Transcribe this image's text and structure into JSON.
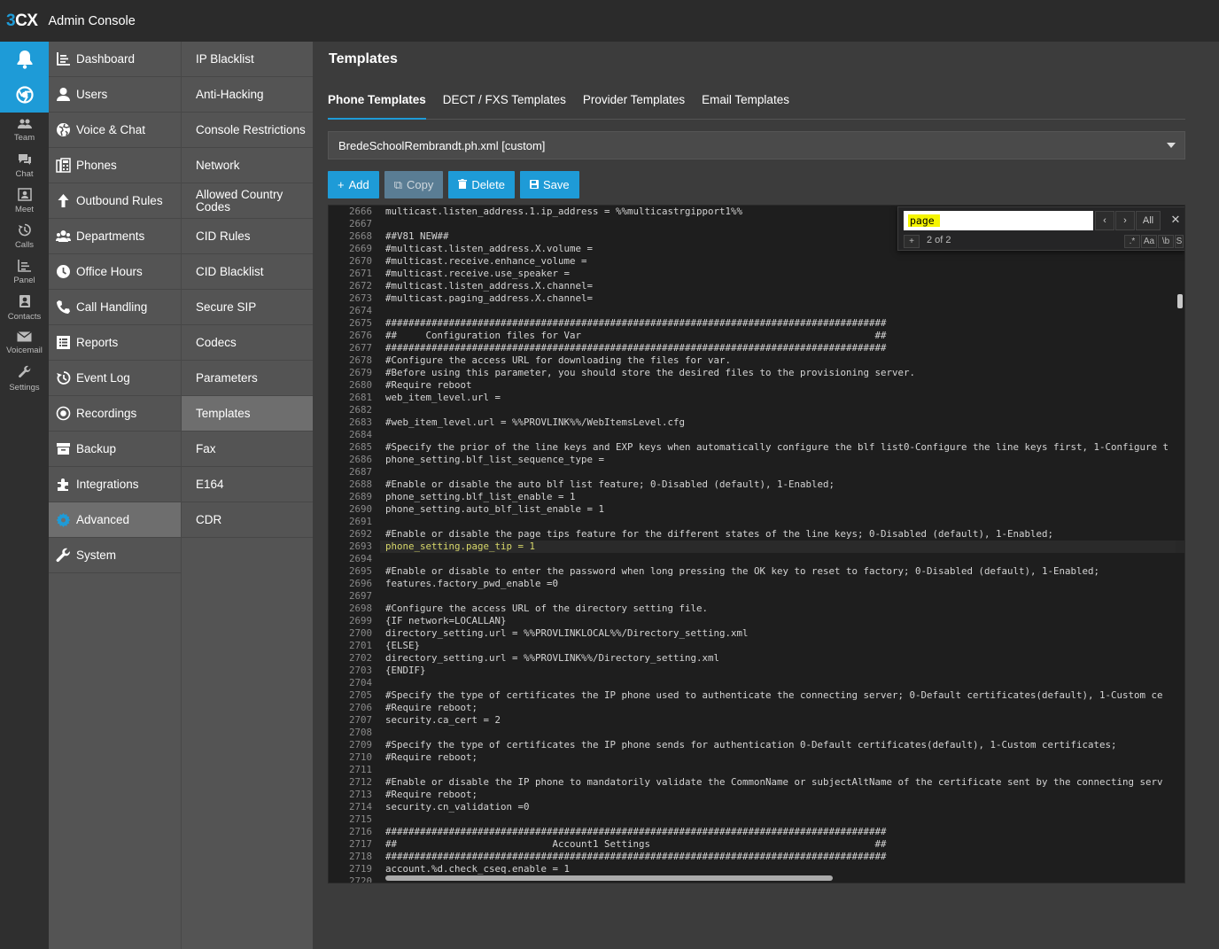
{
  "app": {
    "logo_prefix": "3",
    "logo_suffix": "CX",
    "title": "Admin Console"
  },
  "iconbar": {
    "items": [
      {
        "label": "Team",
        "icon": "team-icon"
      },
      {
        "label": "Chat",
        "icon": "chat-icon"
      },
      {
        "label": "Meet",
        "icon": "meet-icon"
      },
      {
        "label": "Calls",
        "icon": "calls-icon"
      },
      {
        "label": "Panel",
        "icon": "panel-icon"
      },
      {
        "label": "Contacts",
        "icon": "contacts-icon"
      },
      {
        "label": "Voicemail",
        "icon": "voicemail-icon"
      },
      {
        "label": "Settings",
        "icon": "settings-icon"
      }
    ]
  },
  "menu1": [
    "Dashboard",
    "Users",
    "Voice & Chat",
    "Phones",
    "Outbound Rules",
    "Departments",
    "Office Hours",
    "Call Handling",
    "Reports",
    "Event Log",
    "Recordings",
    "Backup",
    "Integrations",
    "Advanced",
    "System"
  ],
  "menu2": [
    "IP Blacklist",
    "Anti-Hacking",
    "Console Restrictions",
    "Network",
    "Allowed Country Codes",
    "CID Rules",
    "CID Blacklist",
    "Secure SIP",
    "Codecs",
    "Parameters",
    "Templates",
    "Fax",
    "E164",
    "CDR"
  ],
  "page": {
    "title": "Templates"
  },
  "tabs": [
    "Phone Templates",
    "DECT / FXS Templates",
    "Provider Templates",
    "Email Templates"
  ],
  "select": {
    "value": "BredeSchoolRembrandt.ph.xml [custom]"
  },
  "buttons": {
    "add": "Add",
    "copy": "Copy",
    "delete": "Delete",
    "save": "Save"
  },
  "find": {
    "query": "page",
    "count": "2 of 2",
    "all": "All",
    "regex": ".*",
    "case": "Aa",
    "word": "\\b",
    "s": "S",
    "plus": "+"
  },
  "editor": {
    "lines": [
      {
        "n": "2666",
        "t": "multicast.listen_address.1.ip_address = %%multicastrgipport1%%"
      },
      {
        "n": "2667",
        "t": ""
      },
      {
        "n": "2668",
        "t": "##V81 NEW##"
      },
      {
        "n": "2669",
        "t": "#multicast.listen_address.X.volume ="
      },
      {
        "n": "2670",
        "t": "#multicast.receive.enhance_volume ="
      },
      {
        "n": "2671",
        "t": "#multicast.receive.use_speaker ="
      },
      {
        "n": "2672",
        "t": "#multicast.listen_address.X.channel="
      },
      {
        "n": "2673",
        "t": "#multicast.paging_address.X.channel="
      },
      {
        "n": "2674",
        "t": ""
      },
      {
        "n": "2675",
        "t": "#######################################################################################"
      },
      {
        "n": "2676",
        "t": "##     Configuration files for Var                                                   ##"
      },
      {
        "n": "2677",
        "t": "#######################################################################################"
      },
      {
        "n": "2678",
        "t": "#Configure the access URL for downloading the files for var."
      },
      {
        "n": "2679",
        "t": "#Before using this parameter, you should store the desired files to the provisioning server."
      },
      {
        "n": "2680",
        "t": "#Require reboot"
      },
      {
        "n": "2681",
        "t": "web_item_level.url ="
      },
      {
        "n": "2682",
        "t": ""
      },
      {
        "n": "2683",
        "t": "#web_item_level.url = %%PROVLINK%%/WebItemsLevel.cfg"
      },
      {
        "n": "2684",
        "t": ""
      },
      {
        "n": "2685",
        "t": "#Specify the prior of the line keys and EXP keys when automatically configure the blf list0-Configure the line keys first, 1-Configure t"
      },
      {
        "n": "2686",
        "t": "phone_setting.blf_list_sequence_type ="
      },
      {
        "n": "2687",
        "t": ""
      },
      {
        "n": "2688",
        "t": "#Enable or disable the auto blf list feature; 0-Disabled (default), 1-Enabled;"
      },
      {
        "n": "2689",
        "t": "phone_setting.blf_list_enable = 1"
      },
      {
        "n": "2690",
        "t": "phone_setting.auto_blf_list_enable = 1"
      },
      {
        "n": "2691",
        "t": ""
      },
      {
        "n": "2692",
        "t": "#Enable or disable the page tips feature for the different states of the line keys; 0-Disabled (default), 1-Enabled;"
      },
      {
        "n": "2693",
        "t": "phone_setting.page_tip = 1"
      },
      {
        "n": "2694",
        "t": ""
      },
      {
        "n": "2695",
        "t": "#Enable or disable to enter the password when long pressing the OK key to reset to factory; 0-Disabled (default), 1-Enabled;"
      },
      {
        "n": "2696",
        "t": "features.factory_pwd_enable =0"
      },
      {
        "n": "2697",
        "t": ""
      },
      {
        "n": "2698",
        "t": "#Configure the access URL of the directory setting file."
      },
      {
        "n": "2699",
        "t": "{IF network=LOCALLAN}"
      },
      {
        "n": "2700",
        "t": "directory_setting.url = %%PROVLINKLOCAL%%/Directory_setting.xml"
      },
      {
        "n": "2701",
        "t": "{ELSE}"
      },
      {
        "n": "2702",
        "t": "directory_setting.url = %%PROVLINK%%/Directory_setting.xml"
      },
      {
        "n": "2703",
        "t": "{ENDIF}"
      },
      {
        "n": "2704",
        "t": ""
      },
      {
        "n": "2705",
        "t": "#Specify the type of certificates the IP phone used to authenticate the connecting server; 0-Default certificates(default), 1-Custom ce"
      },
      {
        "n": "2706",
        "t": "#Require reboot;"
      },
      {
        "n": "2707",
        "t": "security.ca_cert = 2"
      },
      {
        "n": "2708",
        "t": ""
      },
      {
        "n": "2709",
        "t": "#Specify the type of certificates the IP phone sends for authentication 0-Default certificates(default), 1-Custom certificates;"
      },
      {
        "n": "2710",
        "t": "#Require reboot;"
      },
      {
        "n": "2711",
        "t": ""
      },
      {
        "n": "2712",
        "t": "#Enable or disable the IP phone to mandatorily validate the CommonName or subjectAltName of the certificate sent by the connecting serv"
      },
      {
        "n": "2713",
        "t": "#Require reboot;"
      },
      {
        "n": "2714",
        "t": "security.cn_validation =0"
      },
      {
        "n": "2715",
        "t": ""
      },
      {
        "n": "2716",
        "t": "#######################################################################################"
      },
      {
        "n": "2717",
        "t": "##                           Account1 Settings                                       ##"
      },
      {
        "n": "2718",
        "t": "#######################################################################################"
      },
      {
        "n": "2719",
        "t": "account.%d.check_cseq.enable = 1"
      },
      {
        "n": "2720",
        "t": ""
      }
    ]
  },
  "colors": {
    "accent": "#1e9bd7",
    "highlight": "#f5f500"
  }
}
